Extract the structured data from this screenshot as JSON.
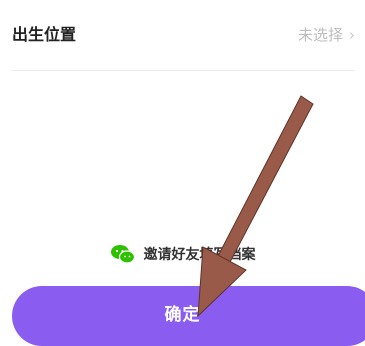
{
  "form": {
    "birthplace_label": "出生位置",
    "birthplace_value": "未选择",
    "chevron_glyph": "›"
  },
  "invite": {
    "text": "邀请好友填写档案",
    "icon": "wechat-icon",
    "icon_color": "#2dc100"
  },
  "confirm": {
    "label": "确定",
    "color": "#8b5cf0"
  },
  "annotation": {
    "icon": "pointer-arrow",
    "color": "#9a5a4a"
  }
}
